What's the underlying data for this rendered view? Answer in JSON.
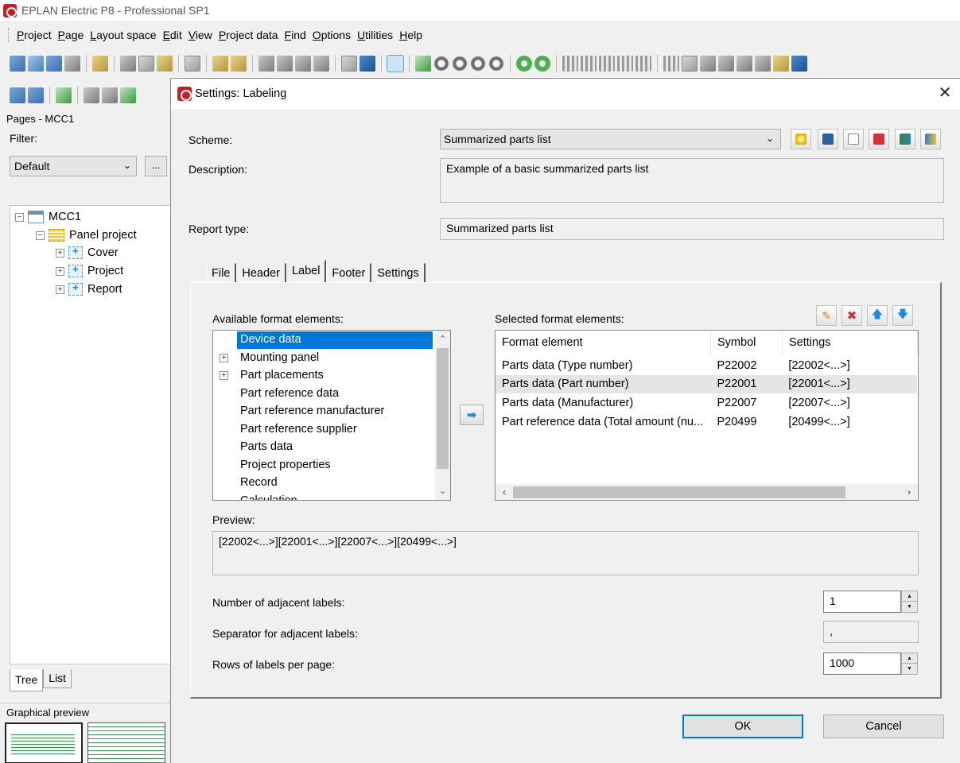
{
  "app": {
    "title": "EPLAN Electric P8 - Professional SP1",
    "menu": [
      "Project",
      "Page",
      "Layout space",
      "Edit",
      "View",
      "Project data",
      "Find",
      "Options",
      "Utilities",
      "Help"
    ]
  },
  "left_panel": {
    "title": "Pages - MCC1",
    "filter_label": "Filter:",
    "filter_value": "Default",
    "filter_more": "...",
    "tree": {
      "root": "MCC1",
      "child": "Panel project",
      "items": [
        "Cover",
        "Project",
        "Report"
      ]
    },
    "tabs": [
      "Tree",
      "List"
    ],
    "preview_title": "Graphical preview"
  },
  "dialog": {
    "title": "Settings: Labeling",
    "scheme_label": "Scheme:",
    "scheme_value": "Summarized parts list",
    "description_label": "Description:",
    "description_value": "Example of a basic summarized parts list",
    "report_type_label": "Report type:",
    "report_type_value": "Summarized parts list",
    "tabs": [
      "File",
      "Header",
      "Label",
      "Footer",
      "Settings"
    ],
    "active_tab": "Label",
    "available_label": "Available format elements:",
    "available_items": [
      "Device data",
      "Mounting panel",
      "Part placements",
      "Part reference data",
      "Part reference manufacturer",
      "Part reference supplier",
      "Parts data",
      "Project properties",
      "Record",
      "Calculation"
    ],
    "selected_label": "Selected format elements:",
    "selected_columns": [
      "Format element",
      "Symbol",
      "Settings"
    ],
    "selected_rows": [
      {
        "element": "Parts data (Type number)",
        "symbol": "P22002",
        "settings": "[22002<...>]"
      },
      {
        "element": "Parts data (Part number)",
        "symbol": "P22001",
        "settings": "[22001<...>]"
      },
      {
        "element": "Parts data (Manufacturer)",
        "symbol": "P22007",
        "settings": "[22007<...>]"
      },
      {
        "element": "Part reference data (Total amount (nu...",
        "symbol": "P20499",
        "settings": "[20499<...>]"
      }
    ],
    "preview_label": "Preview:",
    "preview_value": "[22002<...>][22001<...>][22007<...>][20499<...>]",
    "adjacent_label": "Number of adjacent labels:",
    "adjacent_value": "1",
    "separator_label": "Separator for adjacent labels:",
    "separator_value": ",",
    "rows_label": "Rows of labels per page:",
    "rows_value": "1000",
    "ok_label": "OK",
    "cancel_label": "Cancel"
  },
  "colors": {
    "selection": "#0078d7",
    "dialog_bg": "#f0f0f0",
    "logo_red": "#c81e1e"
  }
}
